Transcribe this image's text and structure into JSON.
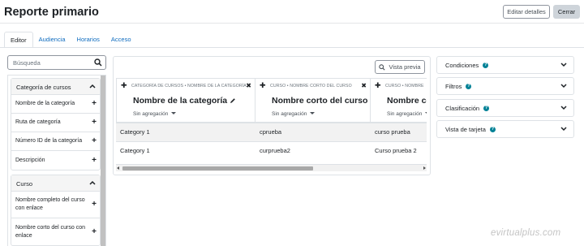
{
  "page": {
    "title": "Reporte primario",
    "edit_details_label": "Editar detalles",
    "close_label": "Cerrar"
  },
  "tabs": [
    {
      "label": "Editor"
    },
    {
      "label": "Audiencia"
    },
    {
      "label": "Horarios"
    },
    {
      "label": "Acceso"
    }
  ],
  "sidebar": {
    "search_placeholder": "Búsqueda",
    "groups": [
      {
        "label": "Categoría de cursos",
        "items": [
          {
            "label": "Nombre de la categoría"
          },
          {
            "label": "Ruta de categoría"
          },
          {
            "label": "Número ID de la categoría"
          },
          {
            "label": "Descripción"
          }
        ]
      },
      {
        "label": "Curso",
        "items": [
          {
            "label": "Nombre completo del curso con enlace"
          },
          {
            "label": "Nombre corto del curso con enlace"
          }
        ]
      }
    ]
  },
  "main": {
    "preview_label": "Vista previa",
    "columns": [
      {
        "source": "CATEGORÍA DE CURSOS • NOMBRE DE LA CATEGORÍA",
        "title": "Nombre de la categoría",
        "aggregation": "Sin agregación"
      },
      {
        "source": "CURSO • NOMBRE CORTO DEL CURSO",
        "title": "Nombre corto del curso",
        "aggregation": "Sin agregación"
      },
      {
        "source": "CURSO • NOMBRE",
        "title": "Nombre co",
        "aggregation": "Sin agregación"
      }
    ],
    "rows": [
      [
        "Category 1",
        "cprueba",
        "curso prueba"
      ],
      [
        "Category 1",
        "curprueba2",
        "Curso prueba 2"
      ]
    ]
  },
  "right_panels": [
    {
      "label": "Condiciones"
    },
    {
      "label": "Filtros"
    },
    {
      "label": "Clasificación"
    },
    {
      "label": "Vista de tarjeta"
    }
  ],
  "watermark": "evirtualplus.com",
  "colors": {
    "link": "#0f6cbf",
    "help_badge": "#008196",
    "border": "#dee2e6"
  }
}
